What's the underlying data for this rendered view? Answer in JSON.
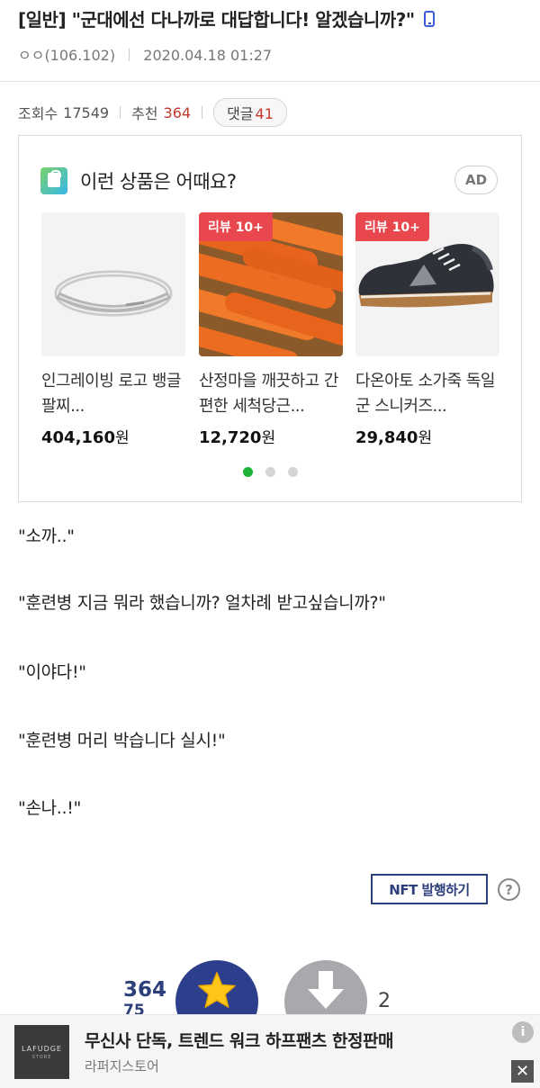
{
  "post": {
    "category": "[일반]",
    "title": "\"군대에선 다나까로 대답합니다! 알겠습니까?\"",
    "author": "ㅇㅇ(106.102)",
    "datetime": "2020.04.18 01:27",
    "views_label": "조회수",
    "views": "17549",
    "recommend_label": "추천",
    "recommend": "364",
    "comments_label": "댓글",
    "comments": "41"
  },
  "ad": {
    "title": "이런 상품은 어때요?",
    "badge": "AD",
    "products": [
      {
        "name": "인그레이빙 로고 뱅글 팔찌...",
        "price": "404,160",
        "currency": "원",
        "badge": ""
      },
      {
        "name": "산정마을 깨끗하고 간편한 세척당근...",
        "price": "12,720",
        "currency": "원",
        "badge": "리뷰 10+"
      },
      {
        "name": "다온아토 소가죽 독일군 스니커즈...",
        "price": "29,840",
        "currency": "원",
        "badge": "리뷰 10+"
      }
    ],
    "active_page": 1,
    "page_count": 3
  },
  "body_lines": [
    "\"소까..\"",
    "\"훈련병 지금 뭐라 했습니까? 얼차례 받고싶습니까?\"",
    "\"이야다!\"",
    "\"훈련병 머리 박습니다 실시!\"",
    "\"손나..!\""
  ],
  "nft_button": "NFT 발행하기",
  "help_icon_label": "?",
  "vote": {
    "recommend_count": "364",
    "recommend_sub": "75",
    "dislike_count": "2"
  },
  "banner": {
    "logo_text": "LAFUDGE",
    "logo_sub": "STORE",
    "title": "무신사 단독, 트렌드 워크 하프팬츠 한정판매",
    "store": "라퍼지스토어",
    "info_label": "i",
    "close_label": "✕"
  },
  "colors": {
    "accent_navy": "#2d3f8c",
    "review_badge": "#e8474e",
    "recommend_red": "#c0392b",
    "carousel_active": "#1fb33a"
  }
}
